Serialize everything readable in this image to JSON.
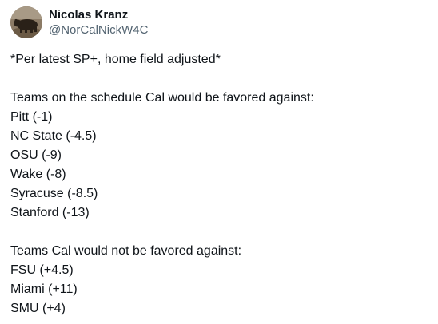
{
  "author": {
    "display_name": "Nicolas Kranz",
    "handle": "@NorCalNickW4C"
  },
  "tweet": {
    "intro": "*Per latest SP+, home field adjusted*",
    "favored_heading": "Teams on the schedule Cal would be favored against:",
    "favored": [
      "Pitt (-1)",
      "NC State (-4.5)",
      "OSU (-9)",
      "Wake (-8)",
      "Syracuse (-8.5)",
      "Stanford (-13)"
    ],
    "not_favored_heading": "Teams Cal would not be favored against:",
    "not_favored": [
      "FSU (+4.5)",
      "Miami (+11)",
      "SMU (+4)"
    ]
  },
  "icons": {
    "avatar": "bear-photo-avatar"
  },
  "colors": {
    "text_primary": "#0f1419",
    "text_secondary": "#536471",
    "background": "#ffffff"
  }
}
